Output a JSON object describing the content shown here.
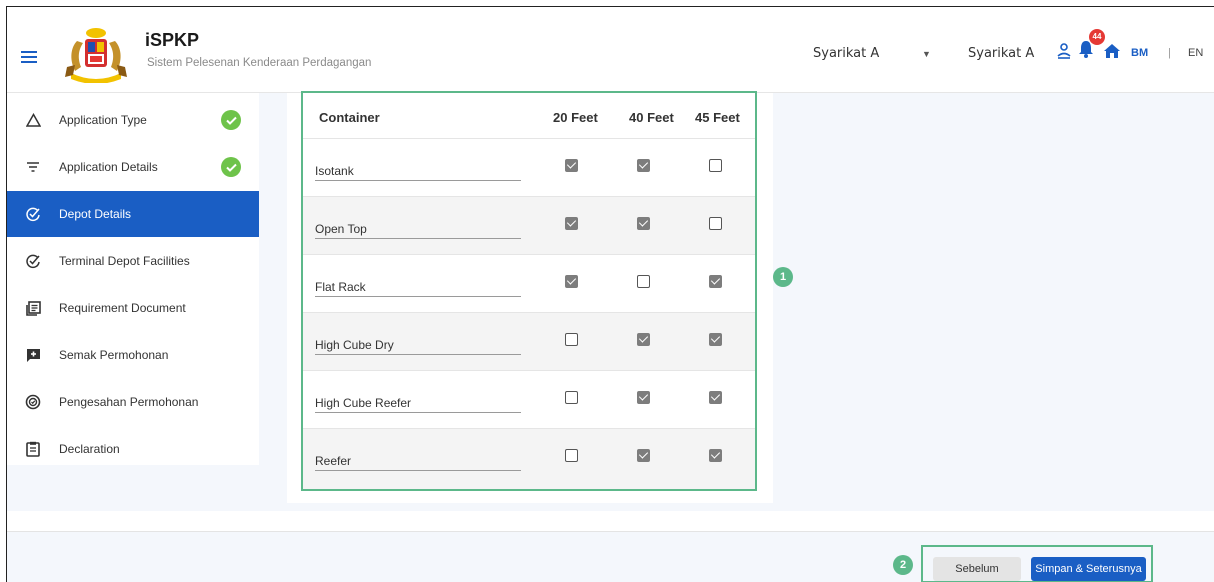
{
  "header": {
    "app_title": "iSPKP",
    "app_subtitle": "Sistem Pelesenan Kenderaan Perdagangan",
    "company_select": "Syarikat A",
    "company_name": "Syarikat A",
    "notification_count": "44",
    "lang_bm": "BM",
    "lang_sep": "|",
    "lang_en": "EN"
  },
  "sidebar": {
    "items": [
      {
        "label": "Application Type",
        "icon": "triangle-icon",
        "completed": true
      },
      {
        "label": "Application Details",
        "icon": "filter-icon",
        "completed": true
      },
      {
        "label": "Depot Details",
        "icon": "check-circle-icon",
        "active": true
      },
      {
        "label": "Terminal Depot Facilities",
        "icon": "check-circle-icon"
      },
      {
        "label": "Requirement Document",
        "icon": "document-icon"
      },
      {
        "label": "Semak Permohonan",
        "icon": "comment-plus-icon"
      },
      {
        "label": "Pengesahan Permohonan",
        "icon": "verified-icon"
      },
      {
        "label": "Declaration",
        "icon": "clipboard-icon"
      }
    ]
  },
  "table": {
    "headers": [
      "Container",
      "20 Feet",
      "40 Feet",
      "45 Feet"
    ],
    "rows": [
      {
        "name": "Isotank",
        "checks": [
          true,
          true,
          false
        ]
      },
      {
        "name": "Open Top",
        "checks": [
          true,
          true,
          false
        ]
      },
      {
        "name": "Flat Rack",
        "checks": [
          true,
          false,
          true
        ]
      },
      {
        "name": "High Cube Dry",
        "checks": [
          false,
          true,
          true
        ]
      },
      {
        "name": "High Cube Reefer",
        "checks": [
          false,
          true,
          true
        ]
      },
      {
        "name": "Reefer",
        "checks": [
          false,
          true,
          true
        ]
      }
    ]
  },
  "markers": {
    "one": "1",
    "two": "2"
  },
  "footer": {
    "prev_label": "Sebelum",
    "next_label": "Simpan & Seterusnya"
  },
  "colors": {
    "primary": "#1a5ec4",
    "success": "#6ec34a",
    "highlight": "#5cb88a",
    "badge": "#e53935"
  }
}
